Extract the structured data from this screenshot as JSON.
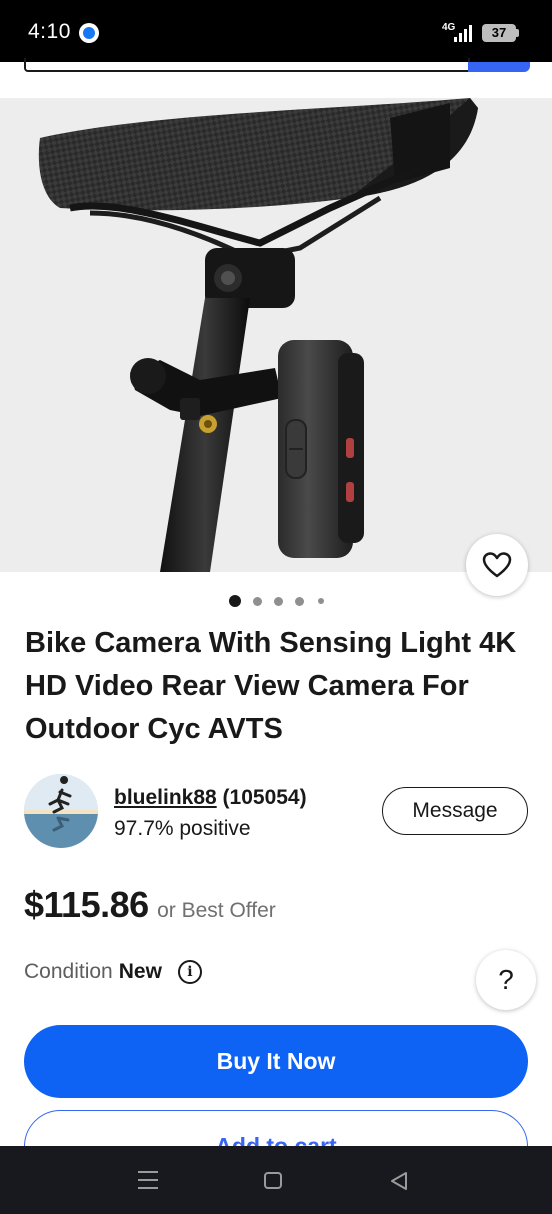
{
  "status_bar": {
    "time": "4:10",
    "network": "4G",
    "battery": "37",
    "notification_icon": "messenger-icon"
  },
  "product": {
    "image_alt": "bike-camera-photo",
    "image_count": 5,
    "active_image_index": 0,
    "title": "Bike Camera With Sensing Light 4K HD Video Rear View Camera For Outdoor Cyc AVTS"
  },
  "seller": {
    "name": "bluelink88",
    "feedback_count": "(105054)",
    "rating": "97.7% positive",
    "message_label": "Message"
  },
  "price": {
    "amount": "$115.86",
    "suffix": "or Best Offer"
  },
  "condition": {
    "label": "Condition",
    "value": "New"
  },
  "help_label": "?",
  "actions": {
    "buy_now_label": "Buy It Now",
    "add_to_cart_label": "Add to cart"
  },
  "colors": {
    "primary": "#0e63f4",
    "link_blue": "#3665f3"
  }
}
